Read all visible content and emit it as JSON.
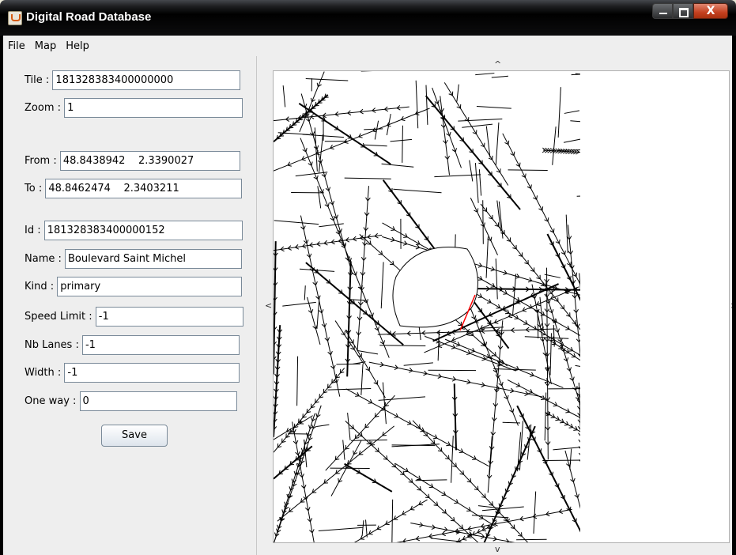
{
  "window": {
    "title": "Digital Road Database",
    "icon": "java-cup-icon"
  },
  "window_buttons": {
    "minimize": "minimize-icon",
    "maximize": "maximize-icon",
    "close_label": "X"
  },
  "menu": [
    "File",
    "Map",
    "Help"
  ],
  "fields": {
    "tile": {
      "label": "Tile : ",
      "value": "181328383400000000"
    },
    "zoom": {
      "label": "Zoom : ",
      "value": "1"
    },
    "from": {
      "label": "From : ",
      "value": "48.8438942    2.3390027"
    },
    "to": {
      "label": "To : ",
      "value": "48.8462474    2.3403211"
    },
    "id": {
      "label": "Id : ",
      "value": "181328383400000152"
    },
    "name": {
      "label": "Name : ",
      "value": "Boulevard Saint Michel"
    },
    "kind": {
      "label": "Kind : ",
      "value": "primary"
    },
    "speed_limit": {
      "label": "Speed Limit : ",
      "value": "-1"
    },
    "nb_lanes": {
      "label": "Nb Lanes : ",
      "value": "-1"
    },
    "width": {
      "label": "Width : ",
      "value": "-1"
    },
    "one_way": {
      "label": "One way : ",
      "value": "0"
    }
  },
  "save_label": "Save",
  "map": {
    "nav": {
      "up": "^",
      "down": "v",
      "left": "<",
      "right": ">"
    },
    "colors": {
      "road": "#000000",
      "selected_segment": "#ff0000",
      "background": "#ffffff"
    }
  }
}
